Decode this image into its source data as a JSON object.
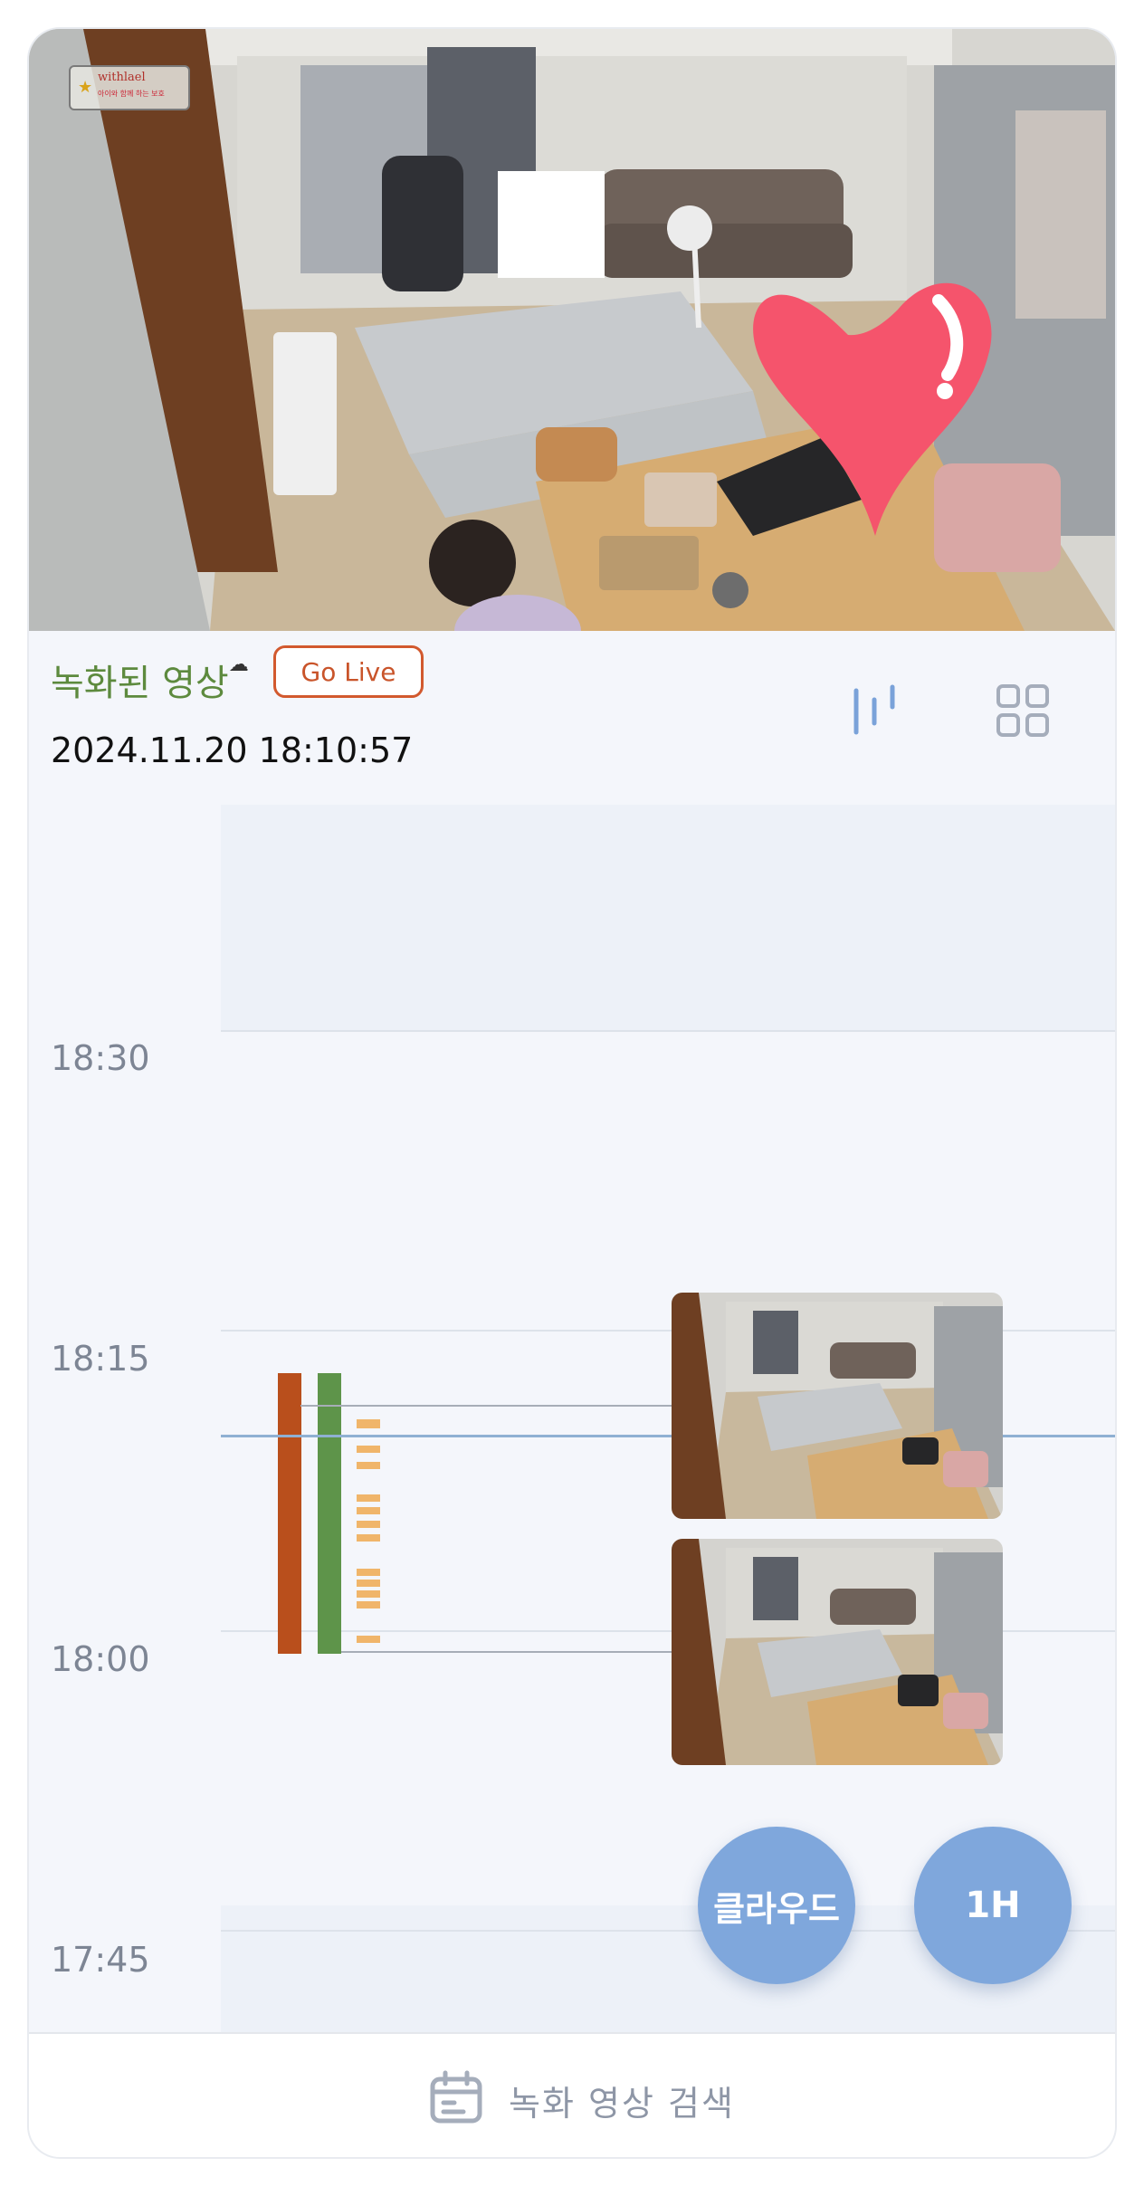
{
  "video": {
    "watermark_brand": "withlael",
    "watermark_sub": "아이와 함께 하는 보호"
  },
  "header": {
    "recorded_title": "녹화된 영상",
    "cloud_glyph": "☁",
    "go_live_label": "Go Live",
    "timestamp": "2024.11.20 18:10:57"
  },
  "icons": {
    "waveform": "waveform-icon",
    "grid": "grid-view-icon",
    "calendar": "calendar-icon"
  },
  "timeline": {
    "labels": [
      "18:30",
      "18:15",
      "18:00",
      "17:45"
    ],
    "event_colors": {
      "event_a": "#b94f1c",
      "event_b": "#5e944a",
      "motion": "#f0b56a"
    }
  },
  "buttons": {
    "cloud": "클라우드",
    "range": "1H"
  },
  "bottom": {
    "search_label": "녹화 영상 검색"
  },
  "colors": {
    "accent_blue": "#7fa7dc",
    "live_orange": "#d2592e",
    "title_green": "#5d8a3e"
  }
}
